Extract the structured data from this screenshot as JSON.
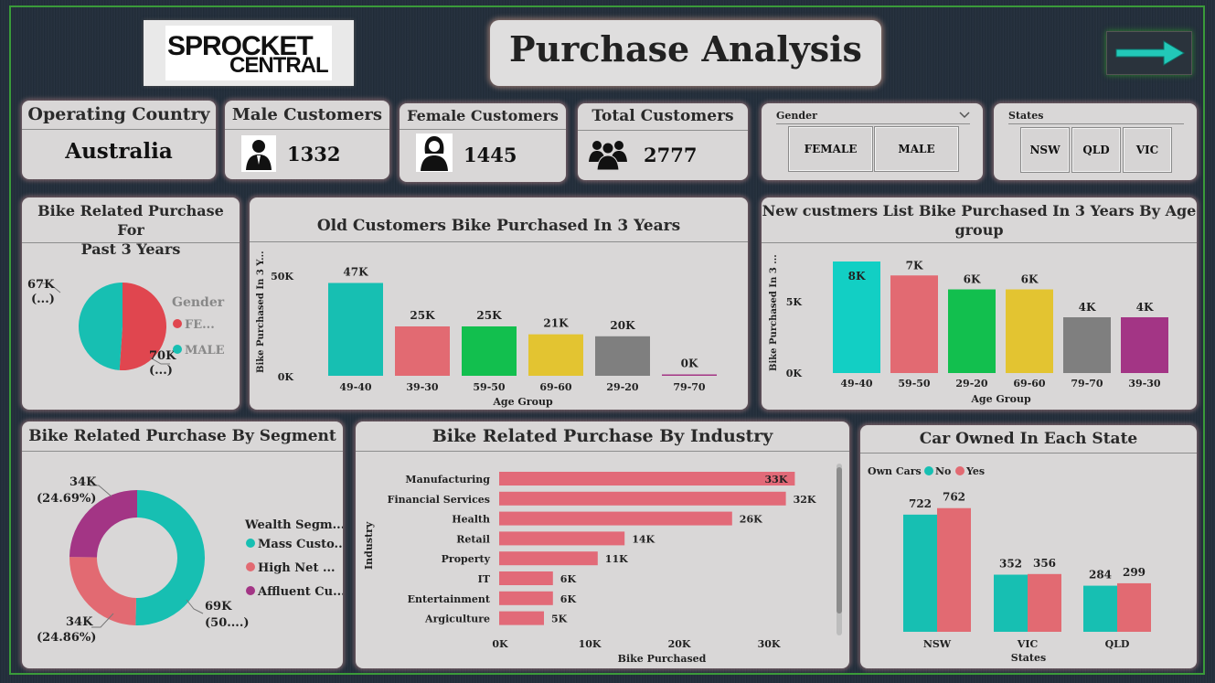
{
  "logo": {
    "line1": "SPROCKET",
    "line2": "CENTRAL"
  },
  "title": "Purchase Analysis",
  "nav": {
    "next_icon": "arrow-right-icon"
  },
  "kpis": {
    "country": {
      "label": "Operating Country",
      "value": "Australia"
    },
    "male": {
      "label": "Male Customers",
      "value": "1332",
      "icon": "male-person-icon"
    },
    "female": {
      "label": "Female Customers",
      "value": "1445",
      "icon": "female-person-icon"
    },
    "total": {
      "label": "Total Customers",
      "value": "2777",
      "icon": "group-icon"
    }
  },
  "slicers": {
    "gender": {
      "label": "Gender",
      "options": [
        "FEMALE",
        "MALE"
      ]
    },
    "states": {
      "label": "States",
      "options": [
        "NSW",
        "QLD",
        "VIC"
      ]
    }
  },
  "colors": {
    "teal": "#17bfb2",
    "coral": "#e26a72",
    "green": "#12bf4e",
    "yellow": "#e3c431",
    "gray": "#7f7f7f",
    "purple": "#a33585",
    "pink_bar": "#e26a78"
  },
  "charts": {
    "gender_pie": {
      "title_line1": "Bike Related Purchase For",
      "title_line2": "Past 3 Years",
      "legend_title": "Gender",
      "legend": [
        "FE...",
        "MALE"
      ],
      "label_a1": "67K",
      "label_a2": "(...)",
      "label_b1": "70K",
      "label_b2": "(...)"
    },
    "old_customers": {
      "title": "Old Customers Bike Purchased In 3 Years",
      "ylabel": "Bike Purchased In 3 Y...",
      "xlabel": "Age Group",
      "ticks": [
        "50K",
        "0K"
      ]
    },
    "new_customers": {
      "title_line1": "New custmers List Bike Purchased In 3 Years By Age",
      "title_line2": "group",
      "ylabel": "Bike Purchased In 3 ...",
      "xlabel": "Age Group",
      "ticks": [
        "5K",
        "0K"
      ]
    },
    "segment": {
      "title": "Bike Related Purchase By Segment",
      "legend_title": "Wealth Segm...",
      "legend": [
        "Mass Custo...",
        "High Net ...",
        "Affluent Cu..."
      ],
      "label_mass1": "69K",
      "label_mass2": "(50....)",
      "label_high1": "34K",
      "label_high2": "(24.86%)",
      "label_aff1": "34K",
      "label_aff2": "(24.69%)"
    },
    "industry": {
      "title": "Bike Related Purchase By Industry",
      "ylabel": "Industry",
      "xlabel": "Bike Purchased",
      "ticks": [
        "0K",
        "10K",
        "20K",
        "30K"
      ]
    },
    "cars": {
      "title": "Car Owned In Each State",
      "legend_title": "Own Cars",
      "legend": [
        "No",
        "Yes"
      ],
      "xlabel": "States"
    }
  },
  "chart_data": [
    {
      "type": "pie",
      "categories": [
        "Female",
        "Male"
      ],
      "values": [
        70,
        67
      ],
      "value_labels": [
        "70K",
        "67K"
      ]
    },
    {
      "type": "bar",
      "categories": [
        "49-40",
        "39-30",
        "59-50",
        "69-60",
        "29-20",
        "79-70"
      ],
      "values": [
        47,
        25,
        25,
        21,
        20,
        0.3
      ],
      "value_labels": [
        "47K",
        "25K",
        "25K",
        "21K",
        "20K",
        "0K"
      ],
      "ylim": [
        0,
        50
      ],
      "bar_colors": [
        "#17bfb2",
        "#e26a72",
        "#12bf4e",
        "#e3c431",
        "#7f7f7f",
        "#a33585"
      ]
    },
    {
      "type": "bar",
      "categories": [
        "49-40",
        "59-50",
        "29-20",
        "69-60",
        "79-70",
        "39-30"
      ],
      "values": [
        8,
        7,
        6,
        6,
        4,
        4
      ],
      "value_labels": [
        "8K",
        "7K",
        "6K",
        "6K",
        "4K",
        "4K"
      ],
      "ylim": [
        0,
        8
      ],
      "bar_colors": [
        "#12cfc4",
        "#e26a72",
        "#12bf4e",
        "#e3c431",
        "#7f7f7f",
        "#a33585"
      ]
    },
    {
      "type": "pie",
      "categories": [
        "Mass Customer",
        "High Net Worth",
        "Affluent Customer"
      ],
      "values": [
        69,
        34,
        34
      ],
      "percent": [
        50.45,
        24.86,
        24.69
      ]
    },
    {
      "type": "bar",
      "orientation": "horizontal",
      "categories": [
        "Manufacturing",
        "Financial Services",
        "Health",
        "Retail",
        "Property",
        "IT",
        "Entertainment",
        "Argiculture"
      ],
      "values": [
        33,
        32,
        26,
        14,
        11,
        6,
        6,
        5
      ],
      "value_labels": [
        "33K",
        "32K",
        "26K",
        "14K",
        "11K",
        "6K",
        "6K",
        "5K"
      ],
      "xlim": [
        0,
        35
      ]
    },
    {
      "type": "bar",
      "categories": [
        "NSW",
        "VIC",
        "QLD"
      ],
      "series": [
        {
          "name": "No",
          "values": [
            722,
            352,
            284
          ]
        },
        {
          "name": "Yes",
          "values": [
            762,
            356,
            299
          ]
        }
      ],
      "ylim": [
        0,
        800
      ]
    }
  ]
}
